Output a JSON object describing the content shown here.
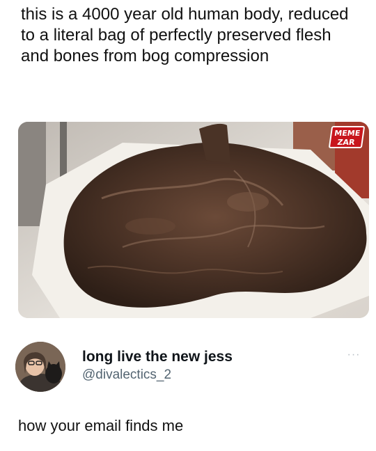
{
  "post": {
    "text": "this is a 4000 year old human body, reduced to a literal bag of perfectly preserved flesh and bones from bog compression"
  },
  "media": {
    "watermark_line1": "MEME",
    "watermark_line2": "ZAR"
  },
  "reply": {
    "display_name": "long live the new jess",
    "handle": "@divalectics_2",
    "more_label": "···",
    "text": "how your email finds me"
  },
  "colors": {
    "watermark": "#c8161d",
    "handle": "#536471"
  }
}
